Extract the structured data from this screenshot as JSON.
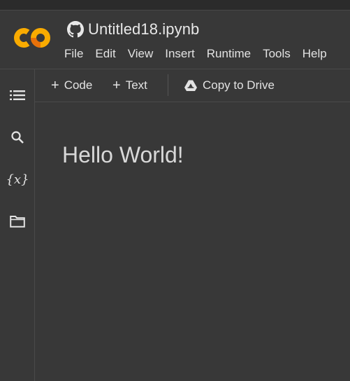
{
  "app": {
    "notebook_title": "Untitled18.ipynb",
    "logo_icon": "colab-logo",
    "logo_colors": {
      "orange": "#f9ab00",
      "deep_orange": "#e8710a"
    }
  },
  "menu": {
    "items": [
      "File",
      "Edit",
      "View",
      "Insert",
      "Runtime",
      "Tools",
      "Help"
    ]
  },
  "sidebar": {
    "icons": [
      "table-of-contents-icon",
      "search-icon",
      "variables-icon",
      "folder-icon"
    ],
    "variables_glyph": "{x}"
  },
  "toolbar": {
    "code_label": "Code",
    "text_label": "Text",
    "copy_to_drive_label": "Copy to Drive",
    "plus_glyph": "+"
  },
  "notebook": {
    "cells": [
      {
        "type": "markdown",
        "heading": "Hello World!"
      }
    ]
  },
  "colors": {
    "background": "#383838",
    "text": "#e3e3e3",
    "divider": "#4a4a4a"
  }
}
